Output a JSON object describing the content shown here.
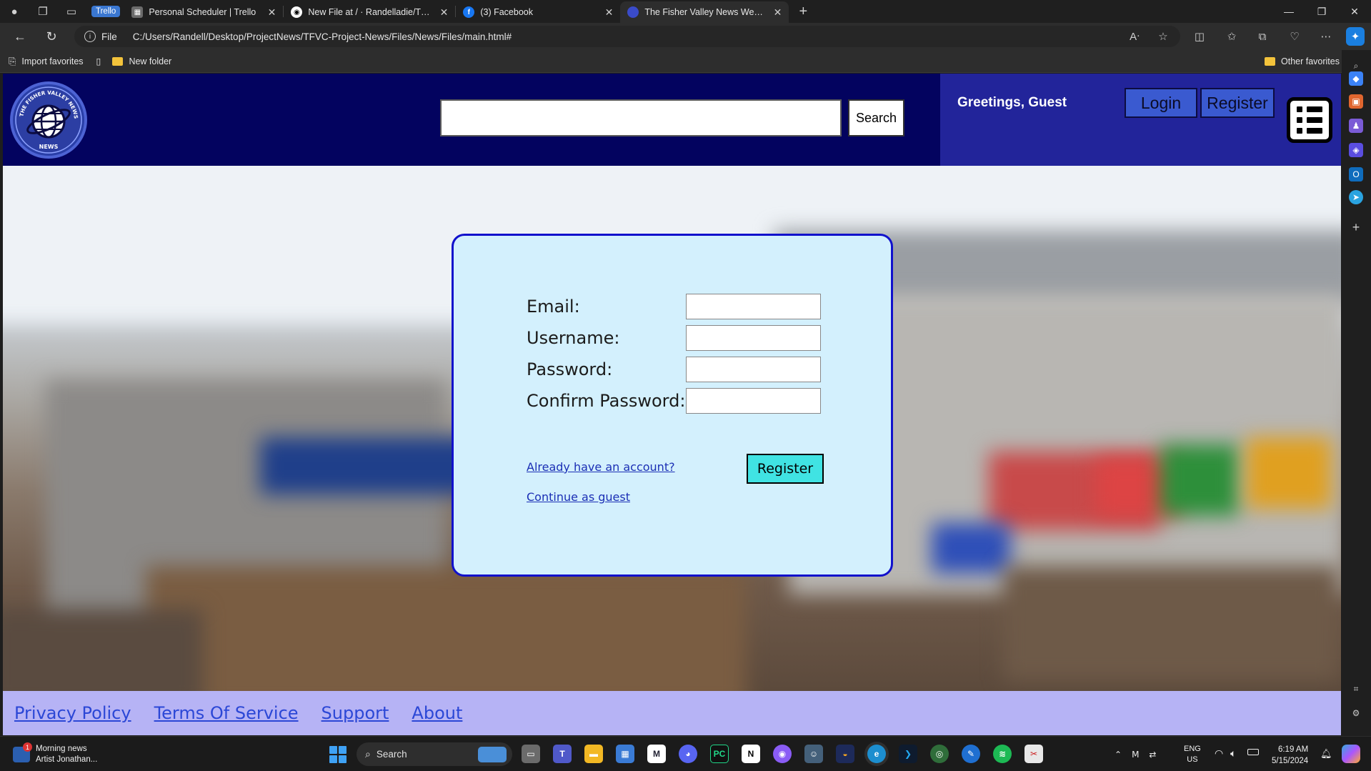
{
  "browser": {
    "tabs": [
      {
        "group": "Trello",
        "title": "Personal Scheduler | Trello"
      },
      {
        "title": "New File at / · Randelladie/TFVC"
      },
      {
        "title": "(3) Facebook"
      },
      {
        "title": "The Fisher Valley News Website"
      }
    ],
    "address": {
      "scheme_label": "File",
      "url": "C:/Users/Randell/Desktop/ProjectNews/TFVC-Project-News/Files/News/Files/main.html#"
    },
    "favorites": {
      "import": "Import favorites",
      "folder": "New folder",
      "other": "Other favorites"
    }
  },
  "site": {
    "logo_text": "THE FISHER VALLEY NEWS WEBSITE",
    "logo_bottom": "NEWS",
    "search_button": "Search",
    "greeting": "Greetings, Guest",
    "login": "Login",
    "register": "Register"
  },
  "form": {
    "email_label": "Email:",
    "username_label": "Username:",
    "password_label": "Password:",
    "confirm_label": "Confirm Password:",
    "have_account_link": "Already have an account?",
    "guest_link": "Continue as guest",
    "submit": "Register"
  },
  "footer": {
    "links": [
      "Privacy Policy",
      "Terms Of Service",
      "Support",
      "About"
    ]
  },
  "taskbar": {
    "news_title": "Morning news",
    "news_sub": "Artist Jonathan...",
    "news_badge": "1",
    "search_label": "Search",
    "lang_1": "ENG",
    "lang_2": "US",
    "time": "6:19 AM",
    "date": "5/15/2024"
  },
  "colors": {
    "header": "#03035f",
    "header_right": "#22249a",
    "card_bg": "#d3f0fd",
    "card_border": "#1111cc",
    "submit_bg": "#40e3e3",
    "footer_bg": "#b6b3f5",
    "link": "#2b47d6"
  }
}
